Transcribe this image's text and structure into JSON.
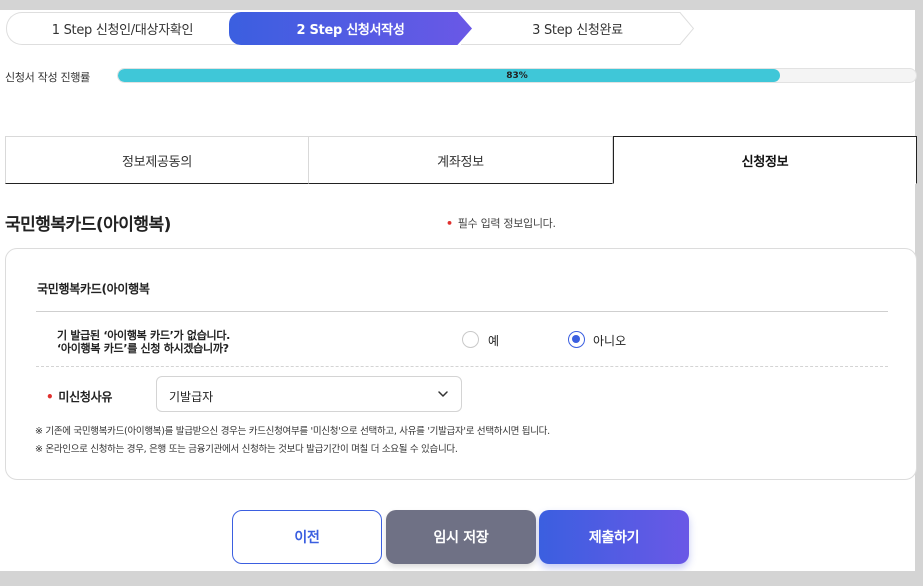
{
  "stepper": {
    "steps": [
      {
        "label": "1 Step 신청인/대상자확인"
      },
      {
        "label": "2 Step 신청서작성",
        "active": true
      },
      {
        "label": "3 Step 신청완료"
      }
    ]
  },
  "progress": {
    "label": "신청서 작성 진행률",
    "percent_text": "83%",
    "value": 0.83,
    "color": "#3fc7d8"
  },
  "tabs": [
    {
      "label": "정보제공동의"
    },
    {
      "label": "계좌정보"
    },
    {
      "label": "신청정보",
      "active": true
    }
  ],
  "section": {
    "title": "국민행복카드(아이행복)",
    "required_note": "필수 입력 정보입니다."
  },
  "card": {
    "title": "국민행복카드(아이행복",
    "question_line1": "기 발급된 ‘아이행복 카드’가 없습니다.",
    "question_line2": "‘아이행복 카드’를 신청 하시겠습니까?",
    "radio_yes": "예",
    "radio_no": "아니오",
    "selected": "아니오",
    "field_label": "미신청사유",
    "select_value": "기발급자",
    "note1": "※ 기존에 국민행복카드(아이행복)를 발급받으신 경우는 카드신청여부를 '미신청'으로 선택하고, 사유를 '기발급자'로 선택하시면 됩니다.",
    "note2": "※ 온라인으로 신청하는 경우, 은행 또는 금융기관에서 신청하는 것보다 발급기간이 며칠 더 소요될 수 있습니다."
  },
  "buttons": {
    "prev": "이전",
    "save": "임시 저장",
    "submit": "제출하기"
  },
  "colors": {
    "accent": "#3b5fe0",
    "accent2": "#6a58e6",
    "required": "#e0312f",
    "save_button": "#6f7185"
  }
}
